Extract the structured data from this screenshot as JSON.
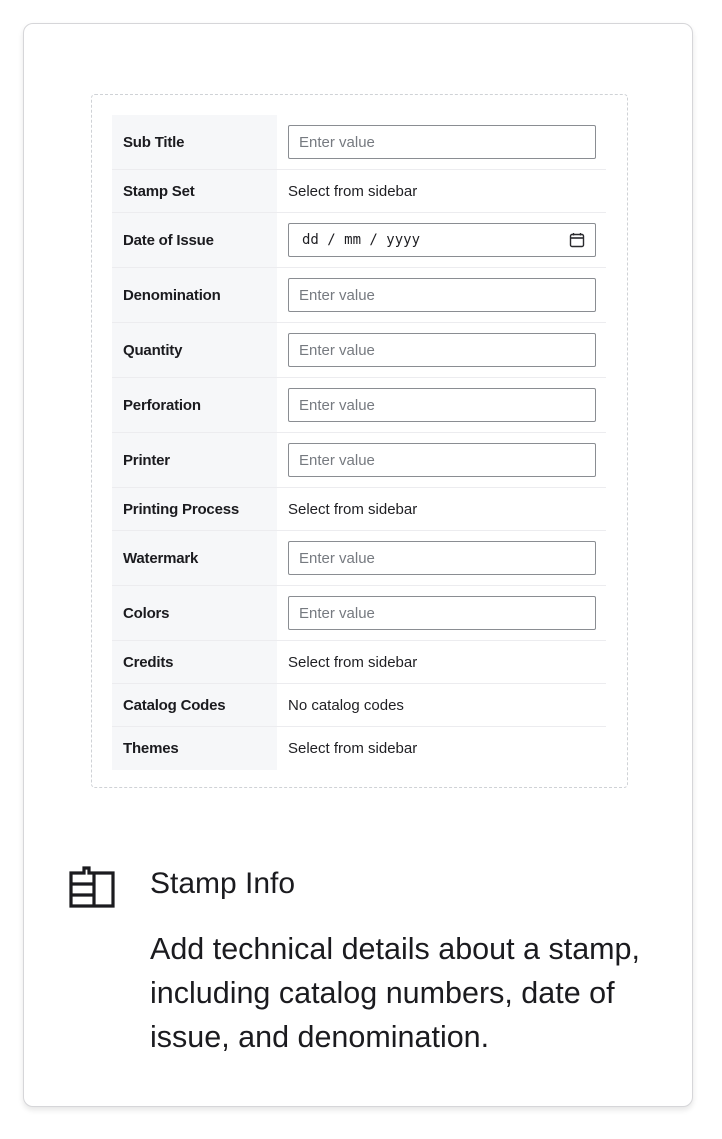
{
  "form": {
    "rows": [
      {
        "label": "Sub Title",
        "type": "input",
        "placeholder": "Enter value"
      },
      {
        "label": "Stamp Set",
        "type": "text",
        "value": "Select from sidebar"
      },
      {
        "label": "Date of Issue",
        "type": "date",
        "value": "dd / mm / yyyy"
      },
      {
        "label": "Denomination",
        "type": "input",
        "placeholder": "Enter value"
      },
      {
        "label": "Quantity",
        "type": "input",
        "placeholder": "Enter value"
      },
      {
        "label": "Perforation",
        "type": "input",
        "placeholder": "Enter value"
      },
      {
        "label": "Printer",
        "type": "input",
        "placeholder": "Enter value"
      },
      {
        "label": "Printing Process",
        "type": "text",
        "value": "Select from sidebar"
      },
      {
        "label": "Watermark",
        "type": "input",
        "placeholder": "Enter value"
      },
      {
        "label": "Colors",
        "type": "input",
        "placeholder": "Enter value"
      },
      {
        "label": "Credits",
        "type": "text",
        "value": "Select from sidebar"
      },
      {
        "label": "Catalog Codes",
        "type": "text",
        "value": "No catalog codes"
      },
      {
        "label": "Themes",
        "type": "text",
        "value": "Select from sidebar"
      }
    ]
  },
  "info": {
    "icon": "form-layout-icon",
    "title": "Stamp Info",
    "description": "Add technical details about a stamp, including catalog numbers, date of issue, and denomination."
  },
  "colors": {
    "label_bg": "#f6f7f9",
    "border": "#d6d6d9",
    "text": "#1b1b1f"
  }
}
